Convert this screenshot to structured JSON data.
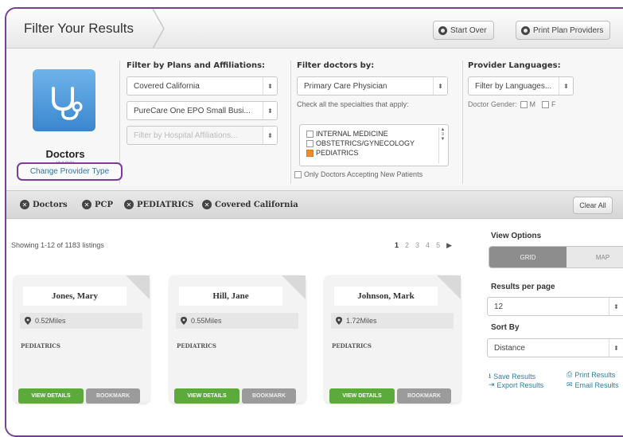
{
  "header": {
    "title": "Filter Your Results",
    "start_over": "Start Over",
    "print_providers": "Print Plan Providers"
  },
  "provider": {
    "type": "Doctors",
    "count": "(1183)",
    "change_link": "Change Provider Type"
  },
  "plans": {
    "title": "Filter by Plans and Affiliations:",
    "plan_select": "Covered California",
    "network_select": "PureCare One EPO Small Busi...",
    "hospital_placeholder": "Filter by Hospital Affiliations..."
  },
  "doctors": {
    "title": "Filter doctors by:",
    "type_select": "Primary Care Physician",
    "specialties_prompt": "Check all the specialties that apply:",
    "specialties": [
      {
        "label": "INTERNAL MEDICINE",
        "checked": false
      },
      {
        "label": "OBSTETRICS/GYNECOLOGY",
        "checked": false
      },
      {
        "label": "PEDIATRICS",
        "checked": true
      }
    ],
    "new_patients": "Only Doctors Accepting New Patients"
  },
  "languages": {
    "title": "Provider Languages:",
    "select": "Filter by Languages...",
    "gender_label": "Doctor Gender:",
    "gender_m": "M",
    "gender_f": "F"
  },
  "chips": [
    "Doctors",
    "PCP",
    "PEDIATRICS",
    "Covered California"
  ],
  "clear_all": "Clear All",
  "results": {
    "showing": "Showing 1-12 of 1183 listings",
    "pages": [
      "1",
      "2",
      "3",
      "4",
      "5"
    ],
    "next": "▶"
  },
  "cards": [
    {
      "name": "Jones, Mary",
      "distance": "0.52Miles",
      "specialty": "PEDIATRICS"
    },
    {
      "name": "Hill, Jane",
      "distance": "0.55Miles",
      "specialty": "PEDIATRICS"
    },
    {
      "name": "Johnson, Mark",
      "distance": "1.72Miles",
      "specialty": "PEDIATRICS"
    }
  ],
  "card_buttons": {
    "view": "VIEW DETAILS",
    "bookmark": "BOOKMARK"
  },
  "side": {
    "view_options": "View Options",
    "grid": "GRID",
    "map": "MAP",
    "per_page_title": "Results per page",
    "per_page": "12",
    "sort_title": "Sort By",
    "sort": "Distance",
    "save": "Save Results",
    "print": "Print Results",
    "export": "Export Results",
    "email": "Email Results"
  },
  "colors": {
    "accent_purple": "#7a3d98",
    "green": "#5daa3c",
    "link": "#2a7fa6",
    "checked": "#ef8b2c"
  }
}
